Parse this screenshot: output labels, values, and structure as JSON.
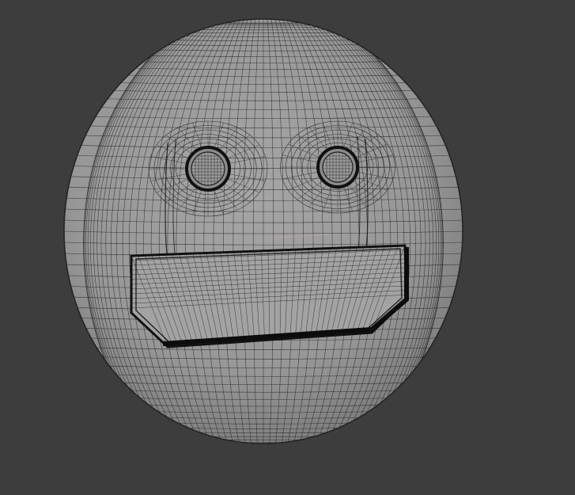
{
  "viewport": {
    "background": "#3d3d3d",
    "mode": "wireframe-on-shaded"
  },
  "model": {
    "shape": "sphere-face",
    "surface_color": "#9b9b9b",
    "wire_color": "#1e1e1e",
    "features": [
      "left-eye",
      "right-eye",
      "mouth-inset"
    ],
    "icon": "emoji-face-mesh"
  }
}
